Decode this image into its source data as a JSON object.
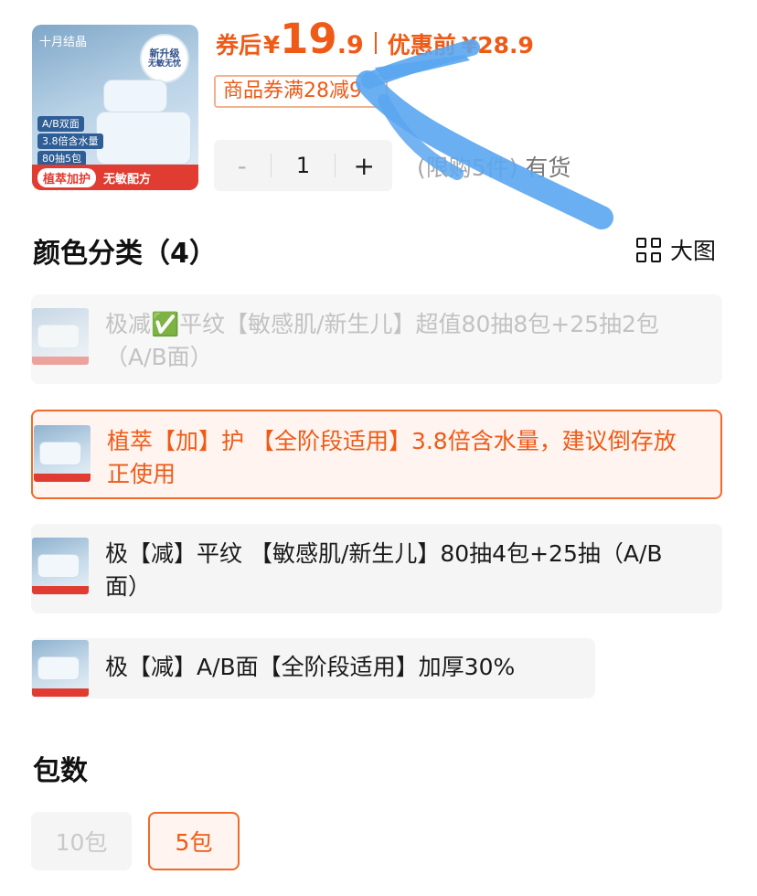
{
  "header": {
    "brand_text": "十月结晶",
    "upgrade_badge": [
      "新升级",
      "无敏无忧"
    ],
    "product_tags": [
      "A/B双面",
      "3.8倍含水量",
      "80抽5包"
    ],
    "bottom_pill": "植萃加护",
    "bottom_text": "无敏配方",
    "price_label": "券后",
    "currency": "¥",
    "price_integer": "19",
    "price_decimal": ".9",
    "original_label": "优惠前",
    "original_price": "¥28.9",
    "coupon_text": "商品券满28减9"
  },
  "quantity": {
    "minus": "-",
    "value": "1",
    "plus": "+",
    "limit_text": "(限购5件)",
    "stock_text": "有货"
  },
  "color_section": {
    "title": "颜色分类（4）",
    "big_view_label": "大图",
    "options": [
      {
        "label": "极减✅平纹【敏感肌/新生儿】超值80抽8包+25抽2包（A/B面）",
        "state": "disabled"
      },
      {
        "label": "植萃【加】护 【全阶段适用】3.8倍含水量，建议倒存放正使用",
        "state": "selected"
      },
      {
        "label": "极【减】平纹 【敏感肌/新生儿】80抽4包+25抽（A/B面）",
        "state": "normal"
      },
      {
        "label": "极【减】A/B面【全阶段适用】加厚30%",
        "state": "normal"
      }
    ]
  },
  "pack_section": {
    "title": "包数",
    "options": [
      {
        "label": "10包",
        "state": "disabled"
      },
      {
        "label": "5包",
        "state": "selected"
      }
    ]
  },
  "colors": {
    "accent": "#ef5a17",
    "accent_border": "#ef6a2a",
    "selected_bg": "#fff4ef",
    "option_bg": "#f5f5f5",
    "disabled_text": "#c2c2c2",
    "brush_stroke": "#5aa6f0"
  }
}
